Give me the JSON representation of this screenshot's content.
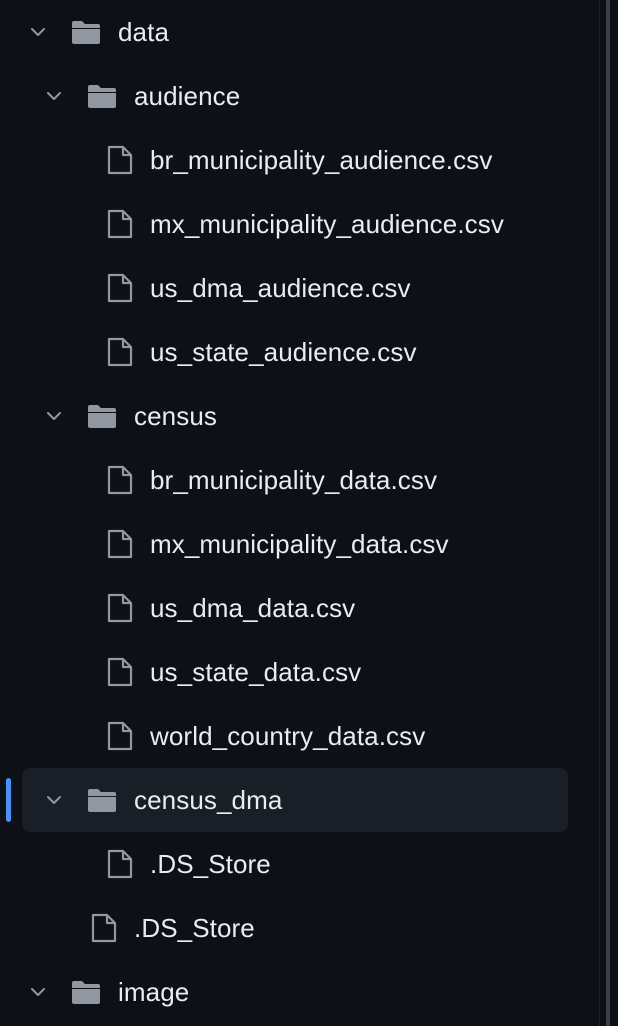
{
  "file_tree": {
    "items": [
      {
        "label": "data",
        "type": "folder",
        "expanded": true,
        "depth": 0
      },
      {
        "label": "audience",
        "type": "folder",
        "expanded": true,
        "depth": 1
      },
      {
        "label": "br_municipality_audience.csv",
        "type": "file",
        "depth": 2
      },
      {
        "label": "mx_municipality_audience.csv",
        "type": "file",
        "depth": 2
      },
      {
        "label": "us_dma_audience.csv",
        "type": "file",
        "depth": 2
      },
      {
        "label": "us_state_audience.csv",
        "type": "file",
        "depth": 2
      },
      {
        "label": "census",
        "type": "folder",
        "expanded": true,
        "depth": 1
      },
      {
        "label": "br_municipality_data.csv",
        "type": "file",
        "depth": 2
      },
      {
        "label": "mx_municipality_data.csv",
        "type": "file",
        "depth": 2
      },
      {
        "label": "us_dma_data.csv",
        "type": "file",
        "depth": 2
      },
      {
        "label": "us_state_data.csv",
        "type": "file",
        "depth": 2
      },
      {
        "label": "world_country_data.csv",
        "type": "file",
        "depth": 2
      },
      {
        "label": "census_dma",
        "type": "folder",
        "expanded": true,
        "depth": 1,
        "selected": true
      },
      {
        "label": ".DS_Store",
        "type": "file",
        "depth": 2
      },
      {
        "label": ".DS_Store",
        "type": "file",
        "depth": 1
      },
      {
        "label": "image",
        "type": "folder",
        "expanded": true,
        "depth": 0
      }
    ]
  },
  "colors": {
    "background": "#0d1117",
    "text": "#e6edf3",
    "icon": "#9198a1",
    "selected_background": "#1a1f27",
    "selected_accent": "#4493f8"
  },
  "icons": {
    "folder": "folder-open-icon",
    "file": "file-icon",
    "chevron": "chevron-down-icon"
  }
}
